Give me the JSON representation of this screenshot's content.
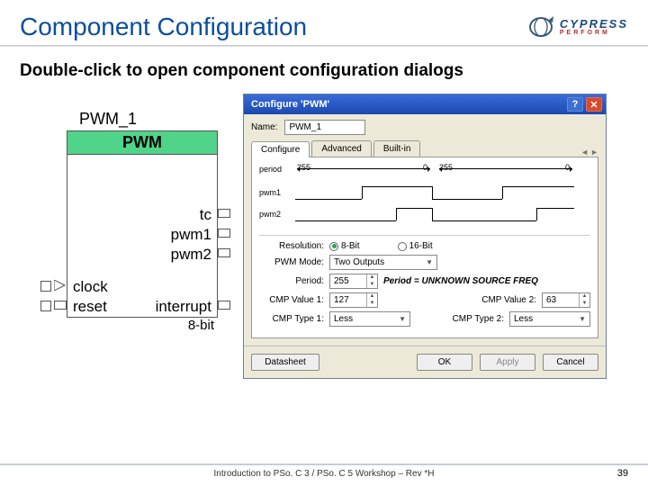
{
  "title": "Component Configuration",
  "logo": {
    "word": "CYPRESS",
    "sub": "PERFORM"
  },
  "subtitle": "Double-click to open component configuration dialogs",
  "component": {
    "name": "PWM_1",
    "header": "PWM",
    "pins_right": [
      "tc",
      "pwm1",
      "pwm2"
    ],
    "pins_left": [
      "clock",
      "reset"
    ],
    "interrupt": "interrupt",
    "footer": "8-bit"
  },
  "dialog": {
    "title": "Configure 'PWM'",
    "name_label": "Name:",
    "name_value": "PWM_1",
    "tabs": [
      "Configure",
      "Advanced",
      "Built-in"
    ],
    "wave": {
      "period": "period",
      "pwm1": "pwm1",
      "pwm2": "pwm2",
      "w1": "255",
      "z1": "0",
      "w2": "255",
      "z2": "0"
    },
    "fields": {
      "resolution": "Resolution:",
      "res_8": "8-Bit",
      "res_16": "16-Bit",
      "pwm_mode": "PWM Mode:",
      "pwm_mode_v": "Two Outputs",
      "period": "Period:",
      "period_v": "255",
      "period_freq": "Period = UNKNOWN SOURCE FREQ",
      "cmp1": "CMP Value 1:",
      "cmp1_v": "127",
      "cmp2": "CMP Value 2:",
      "cmp2_v": "63",
      "cmpt1": "CMP Type 1:",
      "cmpt1_v": "Less",
      "cmpt2": "CMP Type 2:",
      "cmpt2_v": "Less"
    },
    "buttons": {
      "datasheet": "Datasheet",
      "ok": "OK",
      "apply": "Apply",
      "cancel": "Cancel"
    }
  },
  "footer": "Introduction to PSo. C 3 / PSo. C 5 Workshop – Rev *H",
  "page": "39"
}
